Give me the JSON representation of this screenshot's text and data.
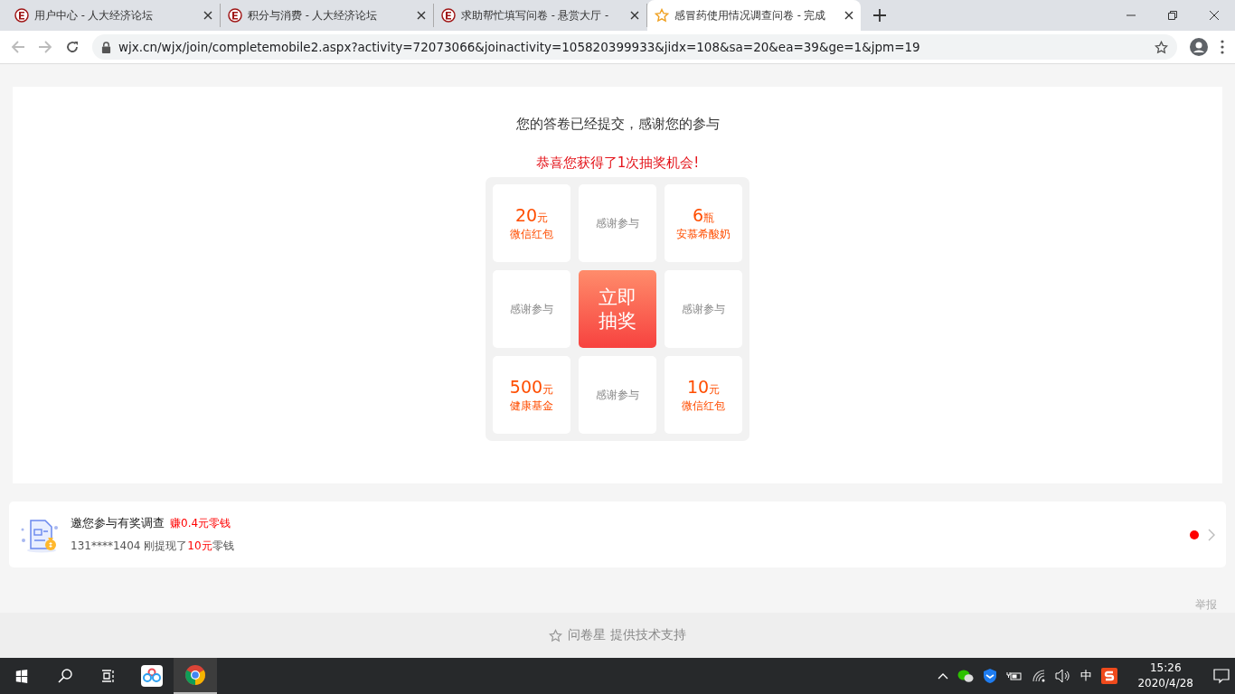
{
  "browser": {
    "tabs": [
      {
        "title": "用户中心 - 人大经济论坛",
        "kind": "forum",
        "selected": false
      },
      {
        "title": "积分与消费 - 人大经济论坛",
        "kind": "forum",
        "selected": false
      },
      {
        "title": "求助帮忙填写问卷 - 悬赏大厅 -",
        "kind": "forum",
        "selected": false
      },
      {
        "title": "感冒药使用情况调查问卷 - 完成",
        "kind": "survey",
        "selected": true
      }
    ],
    "url": "wjx.cn/wjx/join/completemobile2.aspx?activity=72073066&joinactivity=105820399933&jidx=108&sa=20&ea=39&ge=1&jpm=19"
  },
  "result": {
    "message": "您的答卷已经提交，感谢您的参与",
    "congrats": "恭喜您获得了1次抽奖机会!",
    "grid": [
      {
        "kind": "prize",
        "amount": "20",
        "unit": "元",
        "name": "微信红包"
      },
      {
        "kind": "thanks",
        "label": "感谢参与"
      },
      {
        "kind": "prize",
        "amount": "6",
        "unit": "瓶",
        "name": "安慕希酸奶"
      },
      {
        "kind": "thanks",
        "label": "感谢参与"
      },
      {
        "kind": "draw",
        "label": "立即抽奖"
      },
      {
        "kind": "thanks",
        "label": "感谢参与"
      },
      {
        "kind": "prize",
        "amount": "500",
        "unit": "元",
        "name": "健康基金"
      },
      {
        "kind": "thanks",
        "label": "感谢参与"
      },
      {
        "kind": "prize",
        "amount": "10",
        "unit": "元",
        "name": "微信红包"
      }
    ]
  },
  "promo": {
    "title": "邀您参与有奖调查",
    "reward": "赚0.4元零钱",
    "notice": [
      {
        "text": "131****1404 刚提现了",
        "highlight": false
      },
      {
        "text": "10元",
        "highlight": true
      },
      {
        "text": "零钱",
        "highlight": false
      }
    ]
  },
  "report_link": "举报",
  "footer": "问卷星 提供技术支持",
  "taskbar": {
    "time": "15:26",
    "date": "2020/4/28",
    "ime": "中"
  }
}
